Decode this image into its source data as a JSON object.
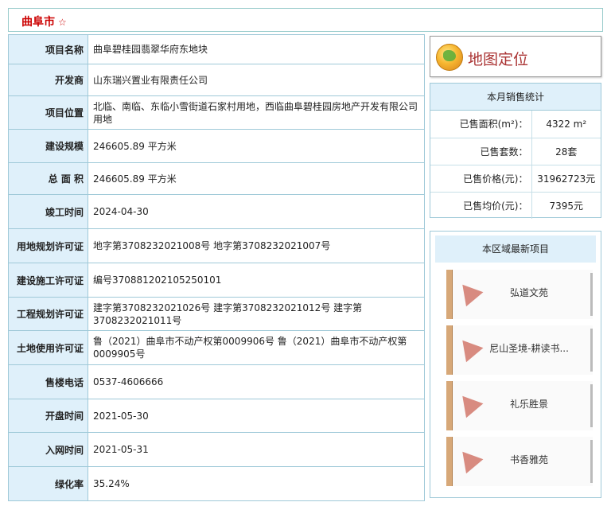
{
  "header": {
    "title": "曲阜市",
    "star": "☆"
  },
  "project": [
    {
      "label": "项目名称",
      "value": "曲阜碧桂园翡翠华府东地块"
    },
    {
      "label": "开发商",
      "value": "山东瑞兴置业有限责任公司"
    },
    {
      "label": "项目位置",
      "value": "北临、南临、东临小雪街道石家村用地，西临曲阜碧桂园房地产开发有限公司用地"
    },
    {
      "label": "建设规模",
      "value": "246605.89 平方米"
    },
    {
      "label": "总 面 积",
      "value": "246605.89 平方米"
    },
    {
      "label": "竣工时间",
      "value": "2024-04-30"
    },
    {
      "label": "用地规划许可证",
      "value": "地字第3708232021008号 地字第3708232021007号"
    },
    {
      "label": "建设施工许可证",
      "value": "编号370881202105250101"
    },
    {
      "label": "工程规划许可证",
      "value": "建字第3708232021026号 建字第3708232021012号 建字第3708232021011号"
    },
    {
      "label": "土地使用许可证",
      "value": "鲁（2021）曲阜市不动产权第0009906号 鲁（2021）曲阜市不动产权第0009905号"
    },
    {
      "label": "售楼电话",
      "value": "0537-4606666"
    },
    {
      "label": "开盘时间",
      "value": "2021-05-30"
    },
    {
      "label": "入网时间",
      "value": "2021-05-31"
    },
    {
      "label": "绿化率",
      "value": "35.24%"
    }
  ],
  "map_button": {
    "label": "地图定位",
    "icon": "globe-icon"
  },
  "stats": {
    "title": "本月销售统计",
    "rows": [
      {
        "label": "已售面积(m²)：",
        "value": "4322 m²"
      },
      {
        "label": "已售套数：",
        "value": "28套"
      },
      {
        "label": "已售价格(元)：",
        "value": "31962723元"
      },
      {
        "label": "已售均价(元)：",
        "value": "7395元"
      }
    ]
  },
  "recent": {
    "title": "本区域最新项目",
    "items": [
      {
        "name": "弘道文苑"
      },
      {
        "name": "尼山圣境-耕读书..."
      },
      {
        "name": "礼乐胜景"
      },
      {
        "name": "书香雅苑"
      }
    ]
  },
  "colors": {
    "title_red": "#cc0000",
    "header_bg": "#dff0fa",
    "border": "#9fc9d8",
    "map_label": "#aa3333"
  }
}
